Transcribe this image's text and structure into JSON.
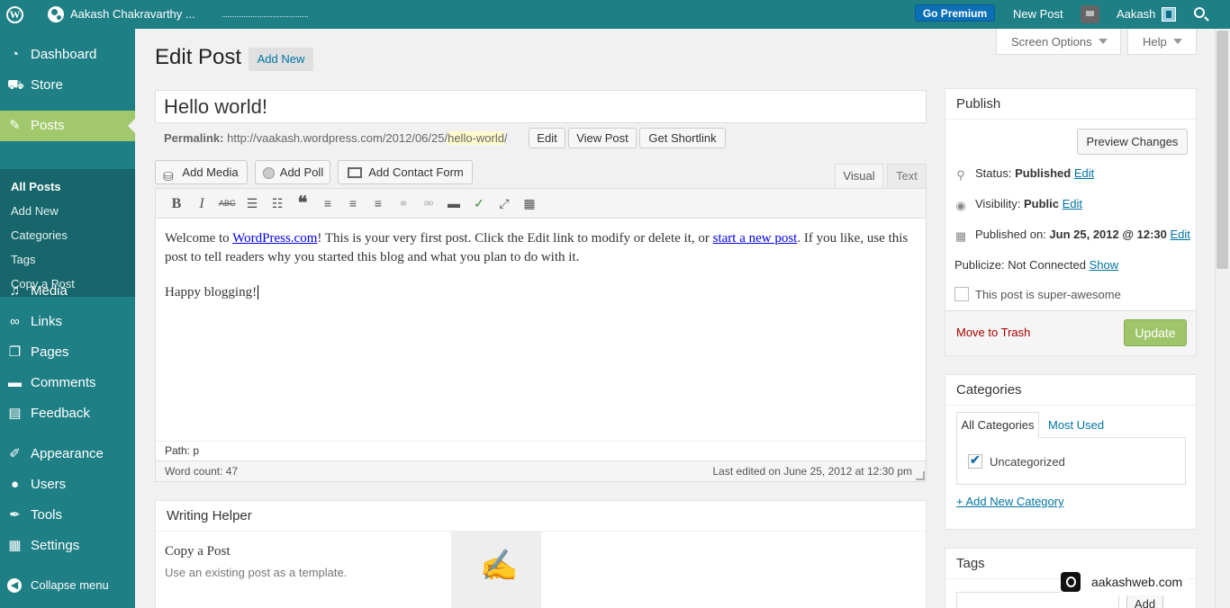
{
  "adminbar": {
    "site_name": "Aakash Chakravarthy ...",
    "go_premium": "Go Premium",
    "new_post": "New Post",
    "user_name": "Aakash"
  },
  "sidebar": {
    "items": [
      {
        "label": "Dashboard",
        "icon": "dashboard-icon"
      },
      {
        "label": "Store",
        "icon": "cart-icon"
      },
      {
        "label": "Posts",
        "icon": "pin-icon"
      },
      {
        "label": "Media",
        "icon": "media-icon"
      },
      {
        "label": "Links",
        "icon": "link-icon"
      },
      {
        "label": "Pages",
        "icon": "pages-icon"
      },
      {
        "label": "Comments",
        "icon": "comment-icon"
      },
      {
        "label": "Feedback",
        "icon": "feedback-icon"
      },
      {
        "label": "Appearance",
        "icon": "brush-icon"
      },
      {
        "label": "Users",
        "icon": "user-icon"
      },
      {
        "label": "Tools",
        "icon": "wrench-icon"
      },
      {
        "label": "Settings",
        "icon": "settings-icon"
      }
    ],
    "submenu": [
      "All Posts",
      "Add New",
      "Categories",
      "Tags",
      "Copy a Post"
    ],
    "collapse": "Collapse menu"
  },
  "header": {
    "title": "Edit Post",
    "add_new": "Add New",
    "screen_options": "Screen Options",
    "help": "Help"
  },
  "post": {
    "title": "Hello world!",
    "permalink_label": "Permalink:",
    "permalink_base": "http://vaakash.wordpress.com/2012/06/25/",
    "permalink_slug": "hello-world",
    "permalink_end": "/",
    "edit": "Edit",
    "view_post": "View Post",
    "get_shortlink": "Get Shortlink"
  },
  "media_buttons": {
    "add_media": "Add Media",
    "add_poll": "Add Poll",
    "add_contact_form": "Add Contact Form"
  },
  "editor": {
    "tab_visual": "Visual",
    "tab_text": "Text",
    "p1_a": "Welcome to ",
    "p1_link1": "WordPress.com",
    "p1_b": "! This is your very first post. Click the Edit link to modify or delete it, or ",
    "p1_link2": "start a new post",
    "p1_c": ". If you like, use this post to tell readers why you started this blog and what you plan to do with it.",
    "p2": "Happy blogging!",
    "path": "Path: p",
    "word_count": "Word count: 47",
    "last_edited": "Last edited on June 25, 2012 at 12:30 pm"
  },
  "writing_helper": {
    "title": "Writing Helper",
    "item_title": "Copy a Post",
    "item_desc": "Use an existing post as a template."
  },
  "publish": {
    "title": "Publish",
    "preview": "Preview Changes",
    "status_label": "Status:",
    "status_value": "Published",
    "visibility_label": "Visibility:",
    "visibility_value": "Public",
    "published_label": "Published on:",
    "published_value": "Jun 25, 2012 @ 12:30",
    "edit": "Edit",
    "publicize_label": "Publicize:",
    "publicize_value": "Not Connected",
    "show": "Show",
    "awesome": "This post is super-awesome",
    "trash": "Move to Trash",
    "update": "Update"
  },
  "categories": {
    "title": "Categories",
    "tab_all": "All Categories",
    "tab_used": "Most Used",
    "item": "Uncategorized",
    "add_new": "+ Add New Category"
  },
  "tags": {
    "title": "Tags",
    "add": "Add"
  },
  "watermark": "aakashweb.com"
}
